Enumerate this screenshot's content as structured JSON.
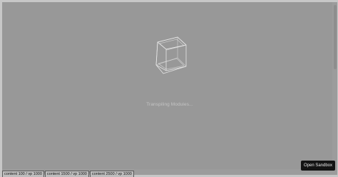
{
  "loading": {
    "message": "Transpiling Modules..."
  },
  "tabs": [
    {
      "label": "content 100 / vp 1000"
    },
    {
      "label": "content 1500 / vp 1000"
    },
    {
      "label": "content 2500 / vp 1000"
    }
  ],
  "open_sandbox": {
    "label": "Open Sandbox"
  },
  "colors": {
    "preview_bg": "#989898",
    "cube_stroke": "#e6e6e6",
    "button_bg": "#141414"
  }
}
